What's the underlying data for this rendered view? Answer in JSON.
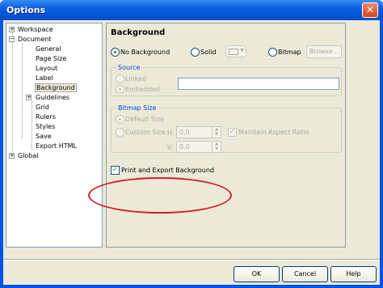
{
  "window": {
    "title": "Options",
    "close_symbol": "✕"
  },
  "tree": {
    "items": [
      {
        "label": "Workspace",
        "expander": "+"
      },
      {
        "label": "Document",
        "expander": "−"
      },
      {
        "label": "General"
      },
      {
        "label": "Page Size"
      },
      {
        "label": "Layout"
      },
      {
        "label": "Label"
      },
      {
        "label": "Background",
        "selected": true
      },
      {
        "label": "Guidelines",
        "expander": "+"
      },
      {
        "label": "Grid"
      },
      {
        "label": "Rulers"
      },
      {
        "label": "Styles"
      },
      {
        "label": "Save"
      },
      {
        "label": "Export HTML"
      },
      {
        "label": "Global",
        "expander": "+"
      }
    ]
  },
  "panel": {
    "title": "Background",
    "bg_type": {
      "no_background": "No Background",
      "solid": "Solid",
      "bitmap": "Bitmap",
      "browse": "Browse...",
      "selected": "no_background"
    },
    "source": {
      "title": "Source",
      "linked": "Linked",
      "embedded": "Embedded",
      "path_value": ""
    },
    "bitmap_size": {
      "title": "Bitmap Size",
      "default_size": "Default Size",
      "custom_size": "Custom Size",
      "h_label": "H:",
      "v_label": "V:",
      "h_value": "0,0",
      "v_value": "0,0",
      "maintain_aspect": "Maintain Aspect Ratio"
    },
    "print_export": {
      "label": "Print and Export Background",
      "checked": true
    }
  },
  "buttons": {
    "ok": "OK",
    "cancel": "Cancel",
    "help": "Help"
  },
  "colors": {
    "highlight": "#d0202a",
    "title_bar": "#0054e3",
    "group_title": "#0046d5"
  }
}
